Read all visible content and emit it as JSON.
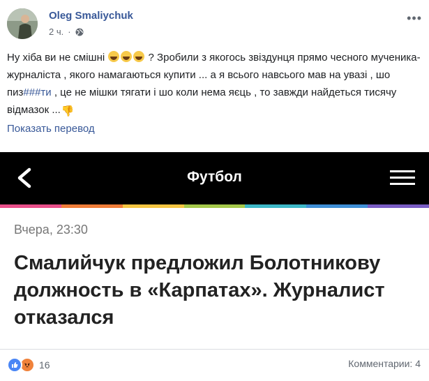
{
  "post": {
    "author": "Oleg Smaliychuk",
    "time": "2 ч.",
    "audience_icon": "globe-icon",
    "text_1": "Ну хіба ви не смішні ",
    "text_2": " ? Зробили з якогось звіздунця прямо чесного мученика-журналіста , якого намагаються купити ... а я всього навсього мав на увазі , шо пиз",
    "text_link": "###ти",
    "text_3": " , це не мішки тягати і шо коли нема яєць , то завжди найдеться тисячу відмазок ...",
    "translate_label": "Показать перевод"
  },
  "shared_image": {
    "section_title": "Футбол",
    "timestamp": "Вчера, 23:30",
    "headline": "Смалийчук предложил Болотникову должность в «Карпатах». Журналист отказался",
    "stripe_colors": [
      "#e94f8a",
      "#f07d38",
      "#f5c642",
      "#a5c94a",
      "#3db8c7",
      "#3f8fd6",
      "#7a5cc4"
    ]
  },
  "footer": {
    "reactions_count": "16",
    "comments_label": "Комментарии: 4"
  },
  "colors": {
    "link": "#385898",
    "like": "#4a86f5",
    "angry": "#f0823b"
  }
}
